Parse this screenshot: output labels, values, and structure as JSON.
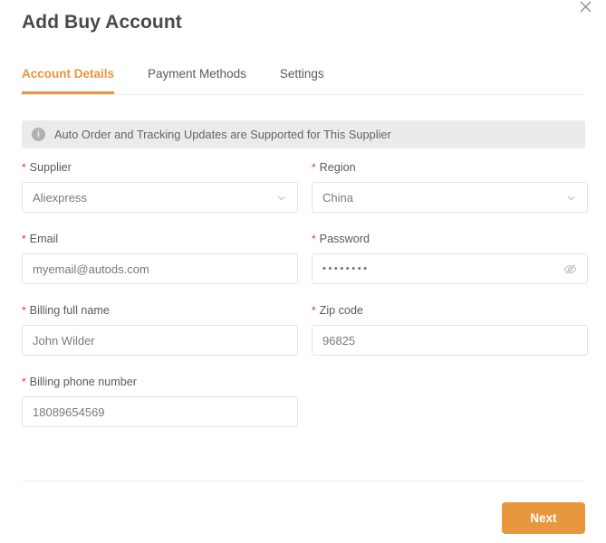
{
  "modal": {
    "title": "Add Buy Account",
    "close_icon": "close-icon"
  },
  "tabs": [
    {
      "label": "Account Details",
      "active": true
    },
    {
      "label": "Payment Methods",
      "active": false
    },
    {
      "label": "Settings",
      "active": false
    }
  ],
  "banner": {
    "icon": "info-icon",
    "text": "Auto Order and Tracking Updates are Supported for This Supplier"
  },
  "form": {
    "supplier": {
      "label": "Supplier",
      "required": "*",
      "value": "Aliexpress",
      "icon": "chevron-down-icon"
    },
    "region": {
      "label": "Region",
      "required": "*",
      "value": "China",
      "icon": "chevron-down-icon"
    },
    "email": {
      "label": "Email",
      "required": "*",
      "value": "myemail@autods.com"
    },
    "password": {
      "label": "Password",
      "required": "*",
      "value": "••••••••",
      "icon": "eye-off-icon"
    },
    "billing_name": {
      "label": "Billing full name",
      "required": "*",
      "value": "John Wilder"
    },
    "zip_code": {
      "label": "Zip code",
      "required": "*",
      "value": "96825"
    },
    "billing_phone": {
      "label": "Billing phone number",
      "required": "*",
      "value": "18089654569"
    }
  },
  "footer": {
    "next_label": "Next"
  },
  "colors": {
    "accent": "#e9973f",
    "required": "#e8302f",
    "banner_bg": "#ebebeb",
    "border": "#e4e4e4"
  }
}
